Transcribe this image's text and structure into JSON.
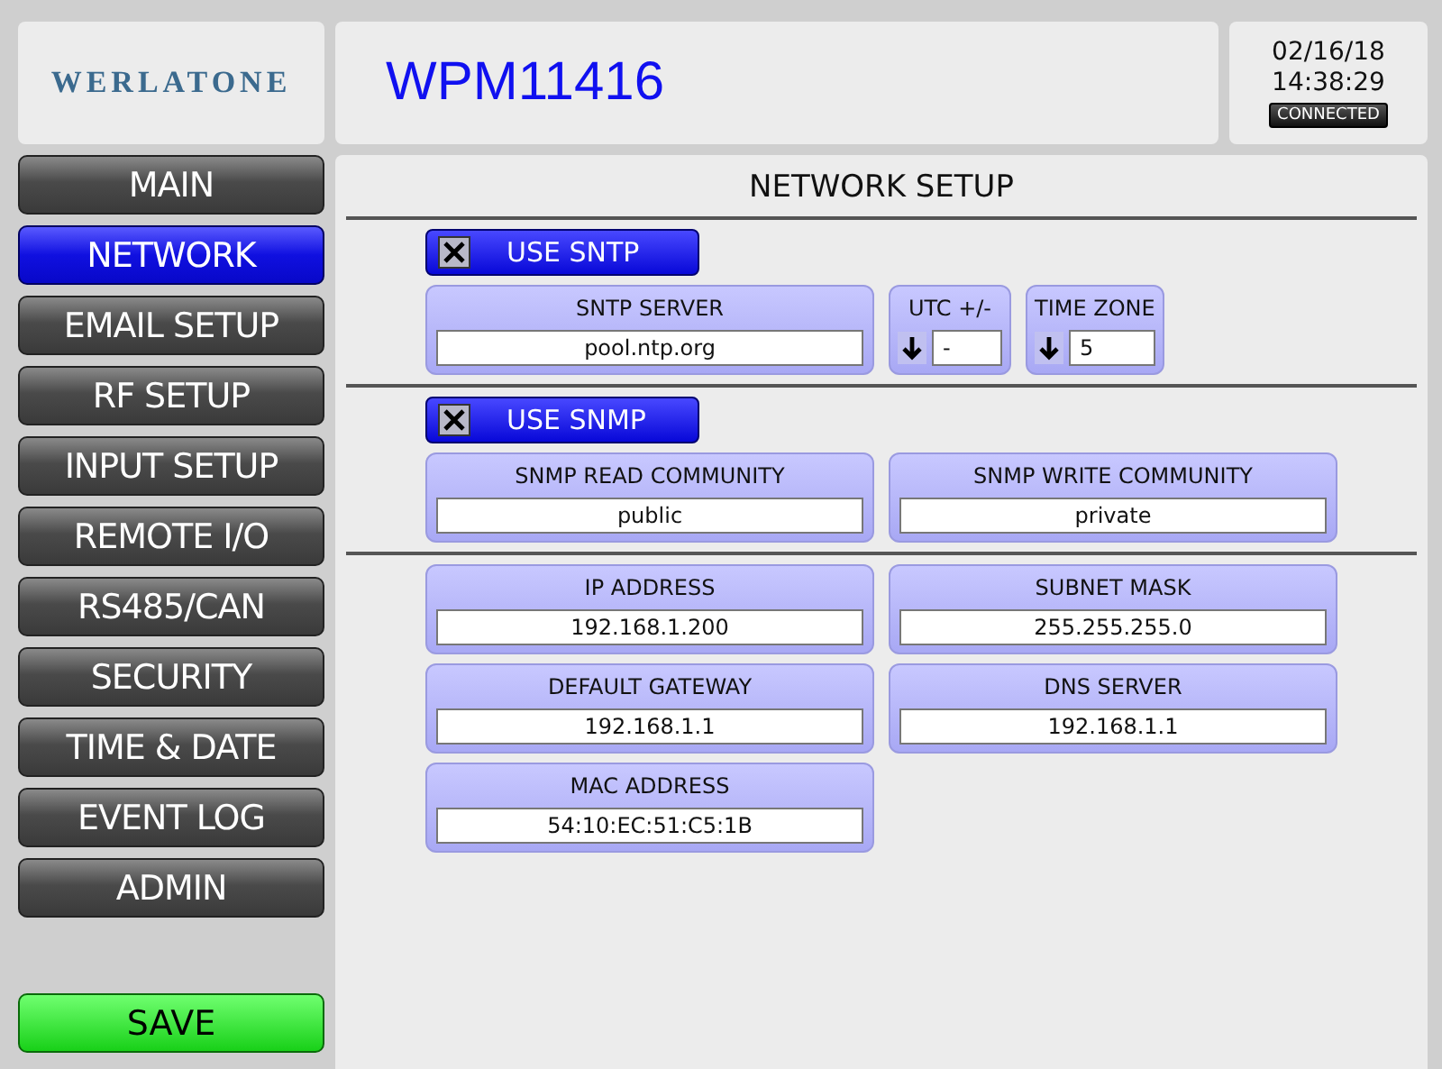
{
  "header": {
    "logo": "WERLATONE",
    "device": "WPM11416",
    "date": "02/16/18",
    "time": "14:38:29",
    "status": "CONNECTED"
  },
  "nav": [
    {
      "label": "MAIN",
      "selected": false
    },
    {
      "label": "NETWORK",
      "selected": true
    },
    {
      "label": "EMAIL SETUP",
      "selected": false
    },
    {
      "label": "RF SETUP",
      "selected": false
    },
    {
      "label": "INPUT SETUP",
      "selected": false
    },
    {
      "label": "REMOTE I/O",
      "selected": false
    },
    {
      "label": "RS485/CAN",
      "selected": false
    },
    {
      "label": "SECURITY",
      "selected": false
    },
    {
      "label": "TIME & DATE",
      "selected": false
    },
    {
      "label": "EVENT LOG",
      "selected": false
    },
    {
      "label": "ADMIN",
      "selected": false
    }
  ],
  "save": "SAVE",
  "page_title": "NETWORK SETUP",
  "sections": [
    {
      "toggle": {
        "label": "USE SNTP",
        "checked": true
      },
      "fields": [
        {
          "kind": "text",
          "label": "SNTP SERVER",
          "value": "pool.ntp.org"
        },
        {
          "kind": "select",
          "label": "UTC +/-",
          "value": "-"
        },
        {
          "kind": "select",
          "label": "TIME ZONE",
          "value": "5"
        }
      ]
    },
    {
      "toggle": {
        "label": "USE SNMP",
        "checked": true
      },
      "fields": [
        {
          "kind": "text",
          "label": "SNMP READ COMMUNITY",
          "value": "public"
        },
        {
          "kind": "text",
          "label": "SNMP WRITE COMMUNITY",
          "value": "private"
        }
      ]
    },
    {
      "fields": [
        {
          "kind": "text",
          "label": "IP ADDRESS",
          "value": "192.168.1.200"
        },
        {
          "kind": "text",
          "label": "SUBNET MASK",
          "value": "255.255.255.0"
        },
        {
          "kind": "text",
          "label": "DEFAULT GATEWAY",
          "value": "192.168.1.1"
        },
        {
          "kind": "text",
          "label": "DNS SERVER",
          "value": "192.168.1.1"
        },
        {
          "kind": "text",
          "label": "MAC ADDRESS",
          "value": "54:10:EC:51:C5:1B"
        }
      ]
    }
  ]
}
